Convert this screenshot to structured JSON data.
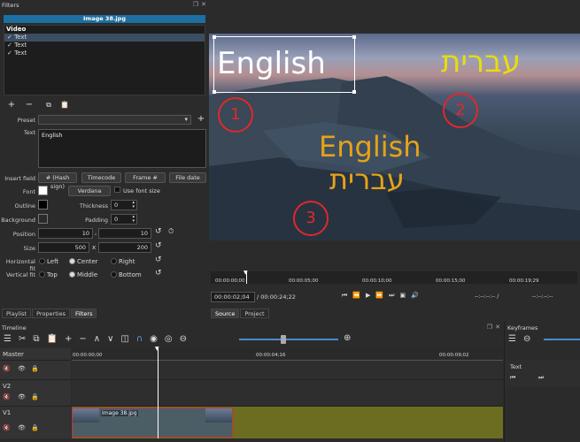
{
  "filters": {
    "title": "Filters",
    "clip_name": "Image 38.jpg",
    "group": "Video",
    "items": [
      "Text",
      "Text",
      "Text"
    ],
    "preset_label": "Preset",
    "text_label": "Text",
    "text_value": "English",
    "insert_field_label": "Insert field",
    "insert_buttons": [
      "# (Hash sign)",
      "Timecode",
      "Frame #",
      "File date"
    ],
    "font_label": "Font",
    "font_name": "Verdana",
    "use_font_size": "Use font size",
    "outline_label": "Outline",
    "thickness_label": "Thickness",
    "thickness_value": "0",
    "background_label": "Background",
    "padding_label": "Padding",
    "padding_value": "0",
    "position_label": "Position",
    "position_x": "10",
    "position_y": "10",
    "size_label": "Size",
    "size_w": "500",
    "size_x": "x",
    "size_h": "200",
    "hfit_label": "Horizontal fit",
    "hfit_options": [
      "Left",
      "Center",
      "Right"
    ],
    "vfit_label": "Vertical fit",
    "vfit_options": [
      "Top",
      "Middle",
      "Bottom"
    ],
    "tabs": [
      "Playlist",
      "Properties",
      "Filters"
    ]
  },
  "preview": {
    "overlay_en_1": "English",
    "overlay_he_1": "עברית",
    "overlay_en_2": "English",
    "overlay_he_2": "עברית",
    "markers": [
      "1",
      "2",
      "3"
    ],
    "ruler": [
      "00:00:00;00",
      "00:00:05;00",
      "00:00:10;00",
      "00:00:15;00",
      "00:00:19;29"
    ],
    "current_time": "00:00:02;04",
    "total_time": "/ 00:00:24;22",
    "in_point": "--:--:--:-- /",
    "out_point": "--:--:--:--",
    "tabs": [
      "Source",
      "Project"
    ],
    "accent": "#e6a317",
    "marker_color": "#e0282c"
  },
  "timeline": {
    "title": "Timeline",
    "tracks": [
      "Master",
      "V2",
      "V1"
    ],
    "ruler": [
      "00:00:00;00",
      "00:00:04;16",
      "00:00:09;02"
    ],
    "clip_label": "Image 38.jpg"
  },
  "keyframes": {
    "title": "Keyframes",
    "track_label": "Text"
  }
}
